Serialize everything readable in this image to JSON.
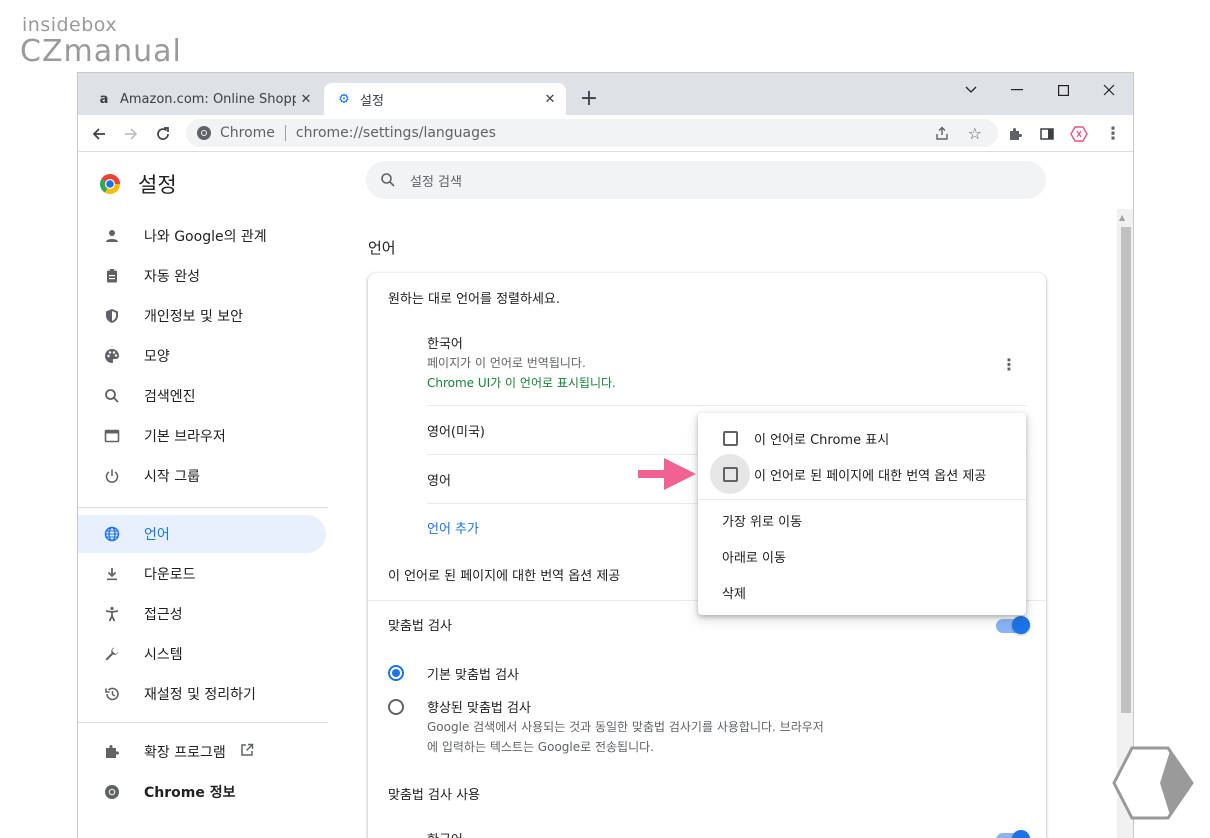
{
  "watermark": {
    "line1": "insidebox",
    "line2": "CZmanual"
  },
  "tabs": [
    {
      "title": "Amazon.com: Online Shopping",
      "favicon": "amazon-icon",
      "favicon_char": "a"
    },
    {
      "title": "설정",
      "favicon": "gear-icon",
      "favicon_char": "⚙"
    }
  ],
  "omnibox": {
    "site": "Chrome",
    "url": "chrome://settings/languages"
  },
  "settings": {
    "title": "설정",
    "search_placeholder": "설정 검색"
  },
  "nav": {
    "items": [
      {
        "label": "나와 Google의 관계",
        "icon": "person-icon",
        "glyph": "👤"
      },
      {
        "label": "자동 완성",
        "icon": "clipboard-icon",
        "glyph": "📋"
      },
      {
        "label": "개인정보 및 보안",
        "icon": "shield-icon",
        "glyph": "🛡"
      },
      {
        "label": "모양",
        "icon": "palette-icon",
        "glyph": "🎨"
      },
      {
        "label": "검색엔진",
        "icon": "search-icon",
        "glyph": "🔍"
      },
      {
        "label": "기본 브라우저",
        "icon": "browser-icon",
        "glyph": "▭"
      },
      {
        "label": "시작 그룹",
        "icon": "power-icon",
        "glyph": "⏻"
      },
      {
        "label": "언어",
        "icon": "globe-icon",
        "glyph": "🌐"
      },
      {
        "label": "다운로드",
        "icon": "download-icon",
        "glyph": "⤓"
      },
      {
        "label": "접근성",
        "icon": "accessibility-icon",
        "glyph": "♿"
      },
      {
        "label": "시스템",
        "icon": "wrench-icon",
        "glyph": "🔧"
      },
      {
        "label": "재설정 및 정리하기",
        "icon": "history-icon",
        "glyph": "⟲"
      }
    ],
    "extensions": "확장 프로그램",
    "about": "Chrome 정보"
  },
  "languages": {
    "section_title": "언어",
    "order_hint": "원하는 대로 언어를 정렬하세요.",
    "list": [
      {
        "name": "한국어",
        "line1": "페이지가 이 언어로 번역됩니다.",
        "line2": "Chrome UI가 이 언어로 표시됩니다."
      },
      {
        "name": "영어(미국)"
      },
      {
        "name": "영어"
      }
    ],
    "add_language": "언어 추가",
    "offer_translate": "이 언어로 된 페이지에 대한 번역 옵션 제공"
  },
  "spellcheck": {
    "title": "맞춤법 검사",
    "basic": "기본 맞춤법 검사",
    "enhanced": "향상된 맞춤법 검사",
    "enhanced_desc1": "Google 검색에서 사용되는 것과 동일한 맞춤법 검사기를 사용합니다. 브라우저",
    "enhanced_desc2": "에 입력하는 텍스트는 Google로 전송됩니다.",
    "use_title": "맞춤법 검사 사용",
    "partial_next": "한국어"
  },
  "context_menu": {
    "display_chrome": "이 언어로 Chrome 표시",
    "offer_translate": "이 언어로 된 페이지에 대한 번역 옵션 제공",
    "move_top": "가장 위로 이동",
    "move_down": "아래로 이동",
    "remove": "삭제"
  },
  "colors": {
    "accent": "#1a73e8",
    "arrow": "#f06292",
    "green": "#188038"
  }
}
